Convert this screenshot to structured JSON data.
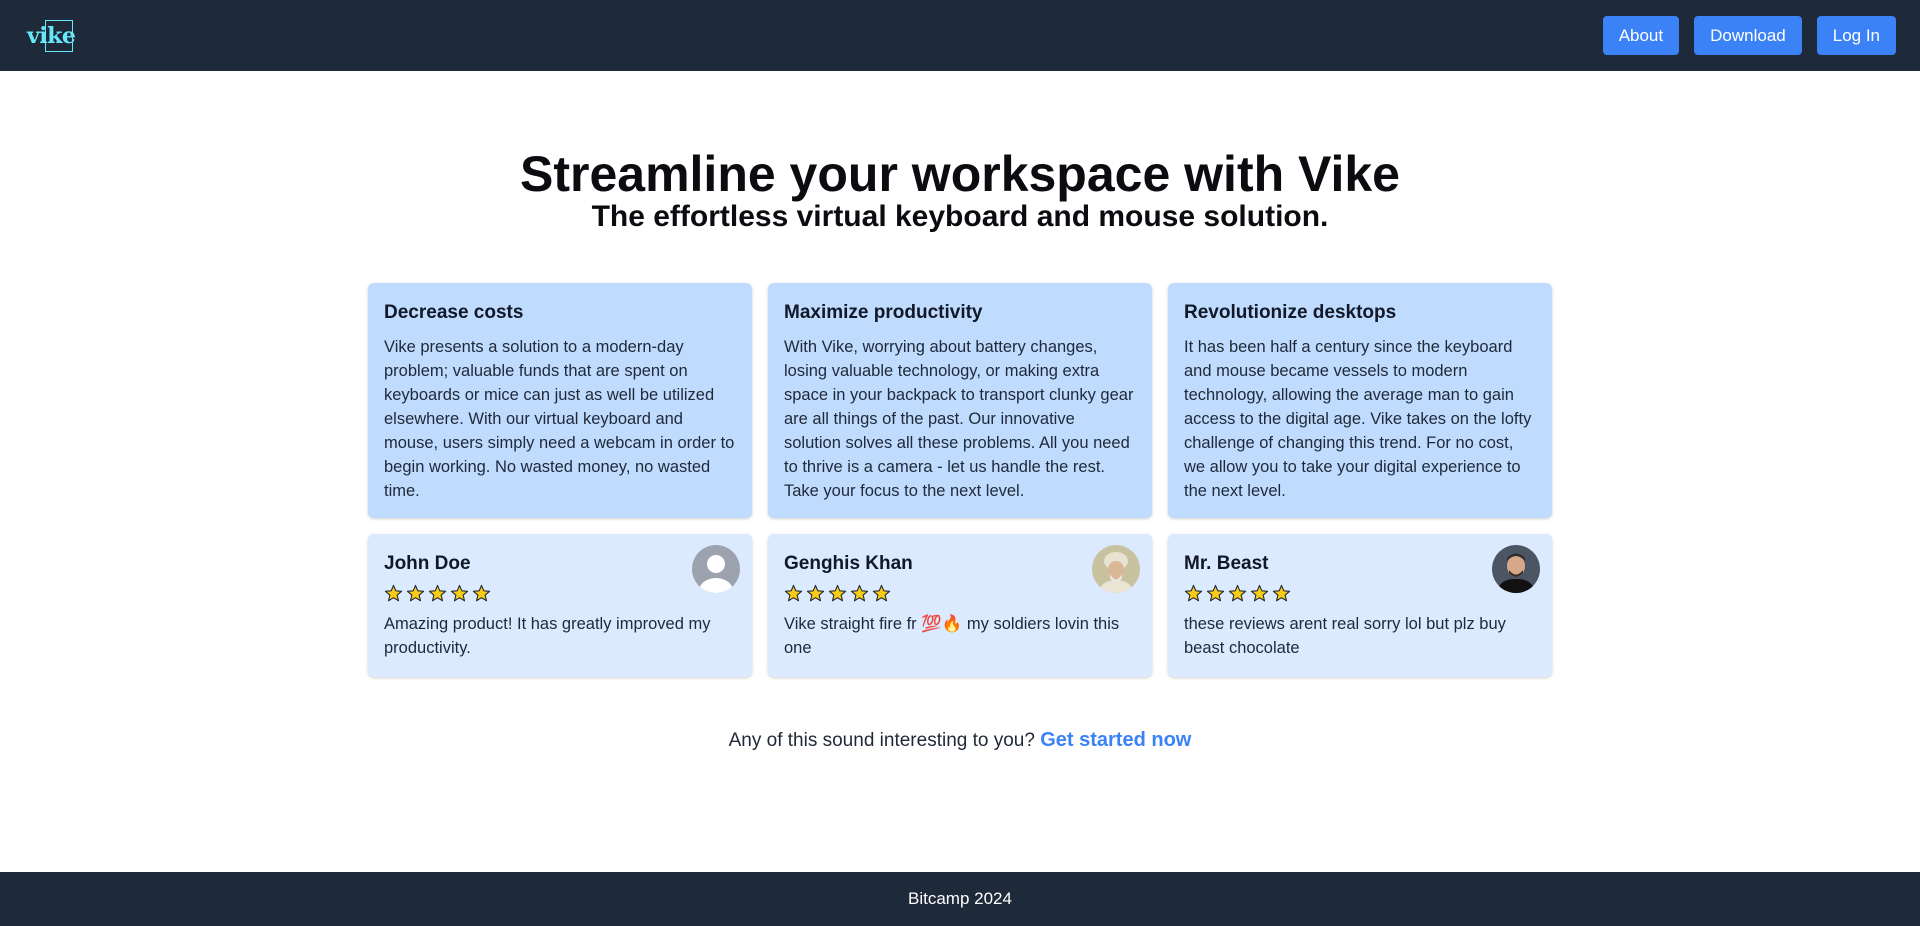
{
  "nav": {
    "logo_text": "vike",
    "buttons": [
      "About",
      "Download",
      "Log In"
    ]
  },
  "hero": {
    "title": "Streamline your workspace with Vike",
    "subtitle": "The effortless virtual keyboard and mouse solution."
  },
  "features": [
    {
      "title": "Decrease costs",
      "body": "Vike presents a solution to a modern-day problem; valuable funds that are spent on keyboards or mice can just as well be utilized elsewhere. With our virtual keyboard and mouse, users simply need a webcam in order to begin working. No wasted money, no wasted time."
    },
    {
      "title": "Maximize productivity",
      "body": "With Vike, worrying about battery changes, losing valuable technology, or making extra space in your backpack to transport clunky gear are all things of the past. Our innovative solution solves all these problems. All you need to thrive is a camera - let us handle the rest. Take your focus to the next level."
    },
    {
      "title": "Revolutionize desktops",
      "body": "It has been half a century since the keyboard and mouse became vessels to modern technology, allowing the average man to gain access to the digital age. Vike takes on the lofty challenge of changing this trend. For no cost, we allow you to take your digital experience to the next level."
    }
  ],
  "reviews": [
    {
      "name": "John Doe",
      "rating": 5,
      "text": "Amazing product! It has greatly improved my productivity.",
      "avatar": "default-user-avatar"
    },
    {
      "name": "Genghis Khan",
      "rating": 5,
      "text": "Vike straight fire fr 💯🔥 my soldiers lovin this one",
      "avatar": "genghis-khan-portrait"
    },
    {
      "name": "Mr. Beast",
      "rating": 5,
      "text": "these reviews arent real sorry lol but plz buy beast chocolate",
      "avatar": "mr-beast-photo"
    }
  ],
  "cta": {
    "text": "Any of this sound interesting to you?",
    "link": "Get started now"
  },
  "footer": {
    "text": "Bitcamp 2024"
  },
  "colors": {
    "navbar": "#1e2939",
    "accent": "#3b82f6",
    "feature_card": "#bfdbfe",
    "review_card": "#dbeafe",
    "star": "#facc15"
  }
}
